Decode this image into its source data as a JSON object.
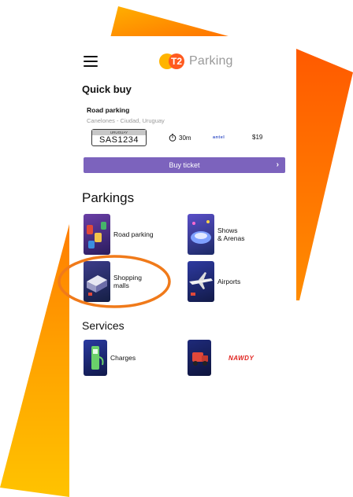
{
  "colors": {
    "accent_orange": "#ff6a00",
    "accent_yellow": "#ffb400",
    "buy_button": "#7c63bd",
    "highlight_ring": "#f07a1a"
  },
  "topbar": {
    "menu_icon": "hamburger-icon",
    "logo_mark": "T2",
    "logo_text": "Parking"
  },
  "quick_buy": {
    "title": "Quick buy",
    "card": {
      "name": "Road parking",
      "location": "Canelones - Ciudad, Uruguay",
      "plate_country": "URUGUAY",
      "plate_number": "SAS1234",
      "duration": "30m",
      "duration_icon": "timer-icon",
      "provider": "antel",
      "price": "$19"
    },
    "buy_button": "Buy ticket",
    "buy_chevron": "›"
  },
  "parkings": {
    "title": "Parkings",
    "items": [
      {
        "label": "Road parking",
        "icon": "road-parking-icon"
      },
      {
        "label": "Shows\n& Arenas",
        "icon": "arena-icon"
      },
      {
        "label": "Shopping\nmalls",
        "icon": "shopping-mall-icon"
      },
      {
        "label": "Airports",
        "icon": "airport-icon"
      }
    ]
  },
  "services": {
    "title": "Services",
    "items": [
      {
        "label": "Charges",
        "icon": "ev-charger-icon"
      },
      {
        "label": "NAWDY",
        "icon": "roadside-assistance-icon"
      }
    ]
  }
}
